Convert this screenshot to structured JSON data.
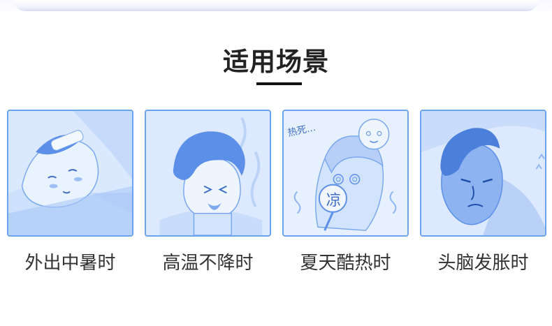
{
  "section": {
    "title": "适用场景"
  },
  "scenes": [
    {
      "caption": "外出中暑时",
      "illustration": "sunstroke-bed-illustration"
    },
    {
      "caption": "高温不降时",
      "illustration": "high-fever-boy-illustration"
    },
    {
      "caption": "夏天酷热时",
      "illustration": "hot-summer-girl-illustration",
      "text_in_image": [
        "热死...",
        "凉"
      ]
    },
    {
      "caption": "头脑发胀时",
      "illustration": "headache-man-illustration"
    }
  ],
  "colors": {
    "card_border": "#6aa3ef",
    "card_bg": "#d8e8ff",
    "figure_blue": "#5b8fe8",
    "title_text": "#222222",
    "caption_text": "#333333"
  }
}
